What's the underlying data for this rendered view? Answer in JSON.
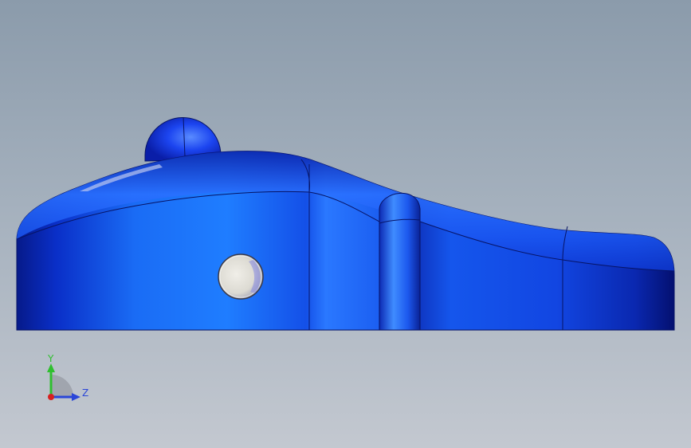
{
  "viewport": {
    "background_top": "#8b9bab",
    "background_bottom": "#c3c8d0"
  },
  "model": {
    "color": "#1a4ef0",
    "edge_color": "#071466",
    "hole_color": "#e4e2dc"
  },
  "triad": {
    "y_label": "Y",
    "z_label": "Z",
    "y_color": "#2fbf2f",
    "z_color": "#2a46d8",
    "x_color": "#d62020"
  }
}
